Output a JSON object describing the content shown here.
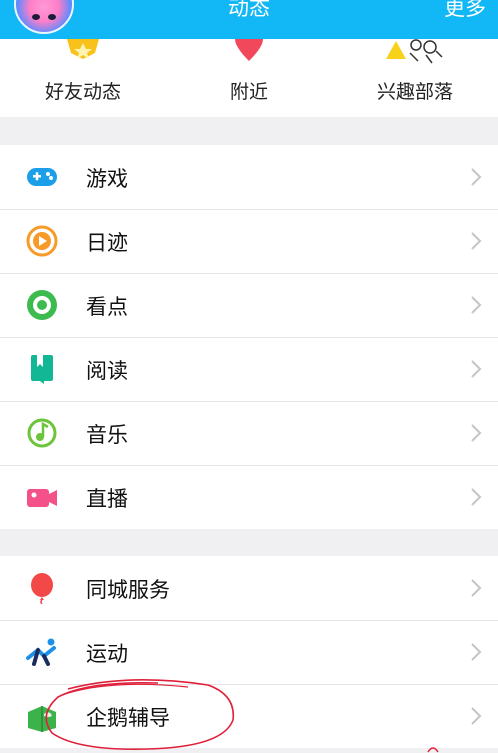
{
  "header": {
    "title": "动态",
    "more_label": "更多"
  },
  "quick_actions": [
    {
      "label": "好友动态",
      "icon": "star-badge-icon"
    },
    {
      "label": "附近",
      "icon": "location-pin-icon"
    },
    {
      "label": "兴趣部落",
      "icon": "tribe-icon"
    }
  ],
  "group1": [
    {
      "label": "游戏",
      "icon": "gamepad-icon"
    },
    {
      "label": "日迹",
      "icon": "play-circle-icon"
    },
    {
      "label": "看点",
      "icon": "eye-icon"
    },
    {
      "label": "阅读",
      "icon": "book-icon"
    },
    {
      "label": "音乐",
      "icon": "music-note-icon"
    },
    {
      "label": "直播",
      "icon": "video-camera-icon"
    }
  ],
  "group2": [
    {
      "label": "同城服务",
      "icon": "balloon-icon"
    },
    {
      "label": "运动",
      "icon": "running-icon"
    },
    {
      "label": "企鹅辅导",
      "icon": "tutoring-icon"
    }
  ],
  "colors": {
    "header": "#12b7f5",
    "accent_red": "#e0203a"
  }
}
